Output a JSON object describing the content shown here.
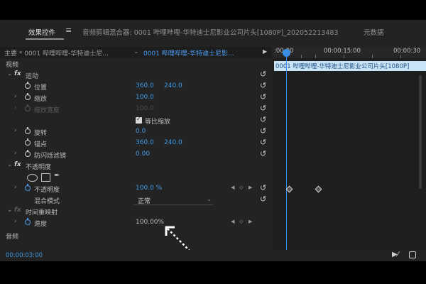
{
  "tabs": [
    {
      "label": "效果控件",
      "active": true
    },
    {
      "label": "音频剪辑混合器: 0001 哔哩哔哩-华特迪士尼影业公司片头[1080P]_202052213483",
      "active": false
    },
    {
      "label": "元数据",
      "active": false
    }
  ],
  "master_bar": {
    "master_label": "主要 * 0001 哔哩哔哩-华特迪士尼...",
    "clip_label": "0001 哔哩哔哩-华特迪士尼影..."
  },
  "sections": {
    "video": "视频",
    "motion": "运动",
    "opacity": "不透明度",
    "time_remap": "时间重映射",
    "audio": "音频"
  },
  "properties": {
    "position": {
      "label": "位置",
      "x": "360.0",
      "y": "240.0"
    },
    "scale": {
      "label": "缩放",
      "value": "100.0"
    },
    "scale_width": {
      "label": "缩放宽度",
      "value": "100.0"
    },
    "uniform_scale": {
      "label": "等比缩放"
    },
    "rotation": {
      "label": "旋转",
      "value": "0.0"
    },
    "anchor": {
      "label": "锚点",
      "x": "360.0",
      "y": "240.0"
    },
    "antiflicker": {
      "label": "防闪烁滤镜",
      "value": "0.00"
    },
    "opacity": {
      "label": "不透明度",
      "value": "100.0 %"
    },
    "blend_mode": {
      "label": "混合模式",
      "value": "正常"
    },
    "speed": {
      "label": "速度",
      "value": "100.00%"
    }
  },
  "timeline": {
    "ticks": [
      ":00:00",
      "00:00:15:00",
      "00:00:30"
    ],
    "clip_name": "0001 哔哩哔哩-华特迪士尼影业公司片头[1080P]"
  },
  "footer": {
    "timecode": "00:00:03:00"
  },
  "colors": {
    "panel_bg": "#232323",
    "value_blue": "#3f9ae8",
    "playhead": "#3b8ee6",
    "clip_bg": "#c9e3f7"
  }
}
